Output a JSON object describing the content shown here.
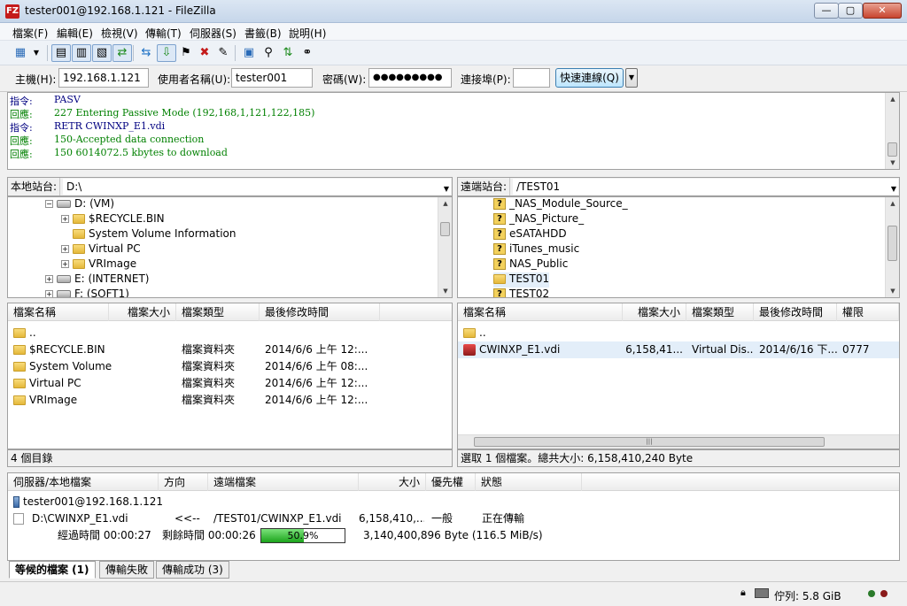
{
  "window": {
    "title": "tester001@192.168.1.121 - FileZilla",
    "app_icon": "FZ",
    "min": "—",
    "max": "▢",
    "close": "✕"
  },
  "menu": [
    "檔案(F)",
    "編輯(E)",
    "檢視(V)",
    "傳輸(T)",
    "伺服器(S)",
    "書籤(B)",
    "說明(H)"
  ],
  "toolbar_icons": [
    "site-manager-icon",
    "dropdown-arrow-icon",
    "toggle-log-icon",
    "toggle-local-tree-icon",
    "toggle-remote-tree-icon",
    "toggle-queue-icon",
    "refresh-icon",
    "process-queue-icon",
    "cancel-icon",
    "disconnect-icon",
    "reconnect-icon",
    "filter-icon",
    "compare-icon",
    "sync-browse-icon",
    "find-icon"
  ],
  "quickconnect": {
    "host_label": "主機(H):",
    "host": "192.168.1.121",
    "user_label": "使用者名稱(U):",
    "user": "tester001",
    "pass_label": "密碼(W):",
    "pass": "●●●●●●●●●",
    "port_label": "連接埠(P):",
    "port": "",
    "button": "快速連線(Q)",
    "dropdown": "▼"
  },
  "log": [
    {
      "label": "指令:",
      "text": "PASV",
      "color": "#000080"
    },
    {
      "label": "回應:",
      "text": "227 Entering Passive Mode (192,168,1,121,122,185)",
      "color": "#008000"
    },
    {
      "label": "指令:",
      "text": "RETR CWINXP_E1.vdi",
      "color": "#000080"
    },
    {
      "label": "回應:",
      "text": "150-Accepted data connection",
      "color": "#008000"
    },
    {
      "label": "回應:",
      "text": "150 6014072.5 kbytes to download",
      "color": "#008000"
    }
  ],
  "local": {
    "site_label": "本地站台:",
    "path": "D:\\",
    "tree": [
      {
        "name": "D: (VM)",
        "icon": "drive",
        "indent": 1,
        "expander": "−"
      },
      {
        "name": "$RECYCLE.BIN",
        "icon": "folder",
        "indent": 2,
        "expander": "+"
      },
      {
        "name": "System Volume Information",
        "icon": "folder",
        "indent": 2,
        "expander": ""
      },
      {
        "name": "Virtual PC",
        "icon": "folder",
        "indent": 2,
        "expander": "+"
      },
      {
        "name": "VRImage",
        "icon": "folder",
        "indent": 2,
        "expander": "+"
      },
      {
        "name": "E: (INTERNET)",
        "icon": "drive",
        "indent": 1,
        "expander": "+"
      },
      {
        "name": "F: (SOFT1)",
        "icon": "drive",
        "indent": 1,
        "expander": "+"
      }
    ],
    "columns": [
      "檔案名稱",
      "檔案大小",
      "檔案類型",
      "最後修改時間"
    ],
    "files": [
      {
        "name": "..",
        "size": "",
        "type": "",
        "modified": ""
      },
      {
        "name": "$RECYCLE.BIN",
        "size": "",
        "type": "檔案資料夾",
        "modified": "2014/6/6 上午 12:..."
      },
      {
        "name": "System Volume...",
        "size": "",
        "type": "檔案資料夾",
        "modified": "2014/6/6 上午 08:..."
      },
      {
        "name": "Virtual PC",
        "size": "",
        "type": "檔案資料夾",
        "modified": "2014/6/6 上午 12:..."
      },
      {
        "name": "VRImage",
        "size": "",
        "type": "檔案資料夾",
        "modified": "2014/6/6 上午 12:..."
      }
    ],
    "status": "4 個目錄"
  },
  "remote": {
    "site_label": "遠端站台:",
    "path": "/TEST01",
    "tree": [
      {
        "name": "_NAS_Module_Source_",
        "icon": "qmark"
      },
      {
        "name": "_NAS_Picture_",
        "icon": "qmark"
      },
      {
        "name": "eSATAHDD",
        "icon": "qmark"
      },
      {
        "name": "iTunes_music",
        "icon": "qmark"
      },
      {
        "name": "NAS_Public",
        "icon": "qmark"
      },
      {
        "name": "TEST01",
        "icon": "folder"
      },
      {
        "name": "TEST02",
        "icon": "qmark"
      }
    ],
    "columns": [
      "檔案名稱",
      "檔案大小",
      "檔案類型",
      "最後修改時間",
      "權限"
    ],
    "files": [
      {
        "name": "..",
        "size": "",
        "type": "",
        "modified": "",
        "perm": ""
      },
      {
        "name": "CWINXP_E1.vdi",
        "size": "6,158,41...",
        "type": "Virtual Dis...",
        "modified": "2014/6/16 下...",
        "perm": "0777"
      }
    ],
    "status": "選取 1 個檔案。總共大小: 6,158,410,240 Byte"
  },
  "queue": {
    "columns": [
      "伺服器/本地檔案",
      "方向",
      "遠端檔案",
      "大小",
      "優先權",
      "狀態"
    ],
    "server": "tester001@192.168.1.121",
    "item": {
      "local": "D:\\CWINXP_E1.vdi",
      "direction": "<<--",
      "remote": "/TEST01/CWINXP_E1.vdi",
      "size": "6,158,410,...",
      "priority": "一般",
      "status": "正在傳輸"
    },
    "elapsed": "經過時間 00:00:27",
    "remaining": "剩餘時間 00:00:26",
    "progress_pct": 50.9,
    "progress_label": "50.9%",
    "transferred": "3,140,400,896 Byte (116.5 MiB/s)"
  },
  "tabs": [
    "等候的檔案 (1)",
    "傳輸失敗",
    "傳輸成功 (3)"
  ],
  "statusbar": {
    "queue": "佇列: 5.8 GiB"
  },
  "colors": {
    "accent": "#3c7fb1",
    "progress": "#1ba41b",
    "selection": "#e3eef9"
  }
}
